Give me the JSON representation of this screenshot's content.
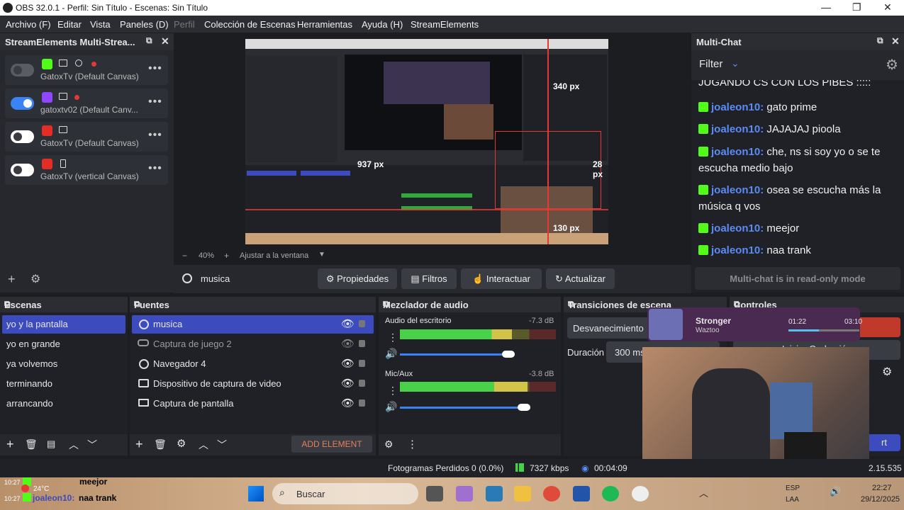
{
  "window": {
    "title": "OBS 32.0.1 - Perfil: Sin Título - Escenas: Sin Título"
  },
  "menu": [
    "Archivo (F)",
    "Editar",
    "Vista",
    "Paneles (D)",
    "Perfil",
    "Colección de Escenas",
    "Herramientas",
    "Ayuda (H)",
    "StreamElements"
  ],
  "multistream": {
    "title": "StreamElements Multi-Strea...",
    "cards": [
      {
        "name": "GatoxTv (Default Canvas)",
        "enabled": false
      },
      {
        "name": "gatoxtv02 (Default Canv...",
        "enabled": true
      },
      {
        "name": "GatoxTv (Default Canvas)",
        "enabled": false
      },
      {
        "name": "GatoxTv (vertical Canvas)",
        "enabled": false
      }
    ],
    "dots": "•••"
  },
  "preview": {
    "labels": {
      "l340": "340 px",
      "l937": "937 px",
      "l28": "28 px",
      "l130": "130 px"
    },
    "zoom": "40%",
    "zoom_minus": "−",
    "zoom_plus": "+",
    "fit": "Ajustar a la ventana"
  },
  "source_toolbar": {
    "current_source": "musica",
    "properties": "Propiedades",
    "filters": "Filtros",
    "interact": "Interactuar",
    "refresh": "Actualizar"
  },
  "multichat": {
    "title": "Multi-Chat",
    "filter": "Filter",
    "partial_top": "JUGANDO CS CON LOS PIBES :::::",
    "messages": [
      {
        "user": "joaleon10:",
        "text": "gato prime"
      },
      {
        "user": "joaleon10:",
        "text": "JAJAJAJ pioola"
      },
      {
        "user": "joaleon10:",
        "text": "che, ns si soy yo o se te escucha medio bajo"
      },
      {
        "user": "joaleon10:",
        "text": "osea se escucha más la música q vos"
      },
      {
        "user": "joaleon10:",
        "text": "meejor"
      },
      {
        "user": "joaleon10:",
        "text": "naa trank"
      }
    ],
    "readonly": "Multi-chat is in read-only mode"
  },
  "scenes": {
    "title": "Escenas",
    "items": [
      "yo y la pantalla",
      "yo en grande",
      "ya volvemos",
      "terminando",
      "arrancando"
    ],
    "selected": 0
  },
  "sources": {
    "title": "Fuentes",
    "items": [
      "musica",
      "Captura de juego 2",
      "Navegador 4",
      "Dispositivo de captura de video",
      "Captura de pantalla"
    ],
    "add_element": "ADD ELEMENT"
  },
  "mixer": {
    "title": "Mezclador de audio",
    "channels": [
      {
        "name": "Audio del escritorio",
        "db": "-7.3 dB",
        "level": 0.72
      },
      {
        "name": "Mic/Aux",
        "db": "-3.8 dB",
        "level": 0.82
      }
    ],
    "scale": [
      "-60",
      "-55",
      "-50",
      "-45",
      "-40",
      "-35",
      "-30",
      "-25",
      "-20",
      "-15",
      "-10",
      "-5",
      "0"
    ]
  },
  "transitions": {
    "title": "Transiciones de escena",
    "value": "Desvanecimiento",
    "duration_label": "Duración",
    "duration_value": "300 ms"
  },
  "controls": {
    "title": "Controles",
    "record": "Iniciar Grabación",
    "partial": "rt"
  },
  "spotify_overlay": {
    "song": "Stronger",
    "artist": "Waztoo",
    "elapsed": "01:22",
    "total": "03:10"
  },
  "statusbar": {
    "dropped": "Fotogramas Perdidos 0 (0.0%)",
    "bitrate": "7327 kbps",
    "time": "00:04:09",
    "version": "2.15.535"
  },
  "overlay_chat": [
    {
      "time": "10:27",
      "user": "joaleon10:",
      "text": "meejor"
    },
    {
      "time": "10:27",
      "user": "joaleon10:",
      "text": "naa trank"
    }
  ],
  "taskbar": {
    "weather": "24°C",
    "search": "Buscar",
    "lang": "ESP",
    "lang2": "LAA",
    "time": "22:27",
    "date": "29/12/2025"
  },
  "colors": {
    "accent": "#3c4bbd",
    "kick": "#53fc18",
    "red": "#e53935",
    "link": "#5b8bf5"
  }
}
